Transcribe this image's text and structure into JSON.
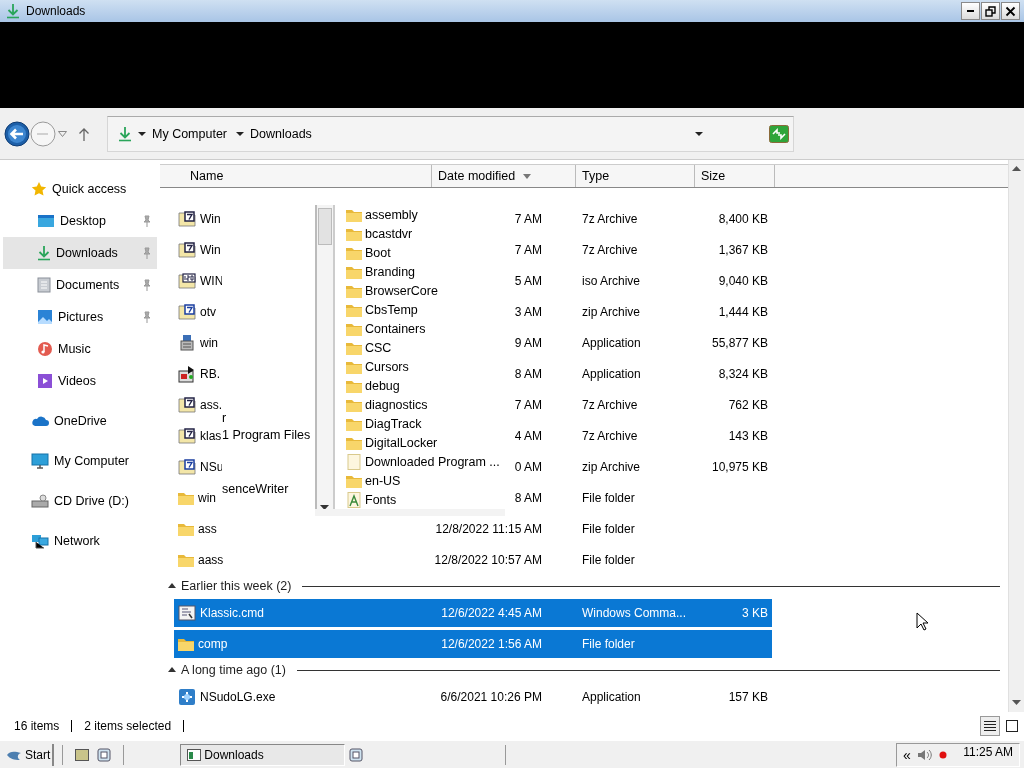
{
  "window": {
    "title": "Downloads"
  },
  "address_bar": {
    "breadcrumb": [
      "My Computer",
      "Downloads"
    ]
  },
  "sidebar": {
    "items": [
      {
        "label": "Quick access",
        "selected": false,
        "children": [
          {
            "label": "Desktop",
            "pinned": true,
            "selected": false
          },
          {
            "label": "Downloads",
            "pinned": true,
            "selected": true
          },
          {
            "label": "Documents",
            "pinned": true,
            "selected": false
          },
          {
            "label": "Pictures",
            "pinned": true,
            "selected": false
          },
          {
            "label": "Music",
            "pinned": false,
            "selected": false
          },
          {
            "label": "Videos",
            "pinned": false,
            "selected": false
          }
        ]
      },
      {
        "label": "OneDrive",
        "selected": false
      },
      {
        "label": "My Computer",
        "selected": false
      },
      {
        "label": "CD Drive (D:)",
        "selected": false
      },
      {
        "label": "Network",
        "selected": false
      }
    ]
  },
  "file_list": {
    "columns": [
      {
        "label": "Name",
        "sorted": false
      },
      {
        "label": "Date modified",
        "sorted": true
      },
      {
        "label": "Type",
        "sorted": false
      },
      {
        "label": "Size",
        "sorted": false
      }
    ],
    "rows": [
      {
        "kind": "sevenzip",
        "name": "Win",
        "date": "7 AM",
        "type": "7z Archive",
        "size": "8,400 KB",
        "selected": false
      },
      {
        "kind": "sevenzip",
        "name": "Win",
        "date": "7 AM",
        "type": "7z Archive",
        "size": "1,367 KB",
        "selected": false
      },
      {
        "kind": "iso",
        "name": "WIN",
        "date": "5 AM",
        "type": "iso Archive",
        "size": "9,040 KB",
        "selected": false
      },
      {
        "kind": "zip",
        "name": "otv",
        "date": "3 AM",
        "type": "zip Archive",
        "size": "1,444 KB",
        "selected": false
      },
      {
        "kind": "installer",
        "name": "win",
        "date": "9 AM",
        "type": "Application",
        "size": "55,877 KB",
        "selected": false
      },
      {
        "kind": "media",
        "name": "RB.",
        "date": "8 AM",
        "type": "Application",
        "size": "8,324 KB",
        "selected": false
      },
      {
        "kind": "sevenzip",
        "name": "ass.",
        "date": "7 AM",
        "type": "7z Archive",
        "size": "762 KB",
        "selected": false
      },
      {
        "kind": "sevenzip",
        "name": "klas",
        "date": "4 AM",
        "type": "7z Archive",
        "size": "143 KB",
        "selected": false
      },
      {
        "kind": "zip",
        "name": "NSu",
        "date": "0 AM",
        "type": "zip Archive",
        "size": "10,975 KB",
        "selected": false
      },
      {
        "kind": "folder",
        "name": "win",
        "date": "8 AM",
        "type": "File folder",
        "selected": false
      },
      {
        "kind": "folder",
        "name": "ass",
        "date": "12/8/2022 11:15 AM",
        "type": "File folder",
        "selected": false
      },
      {
        "kind": "folder",
        "name": "aass",
        "date": "12/8/2022 10:57 AM",
        "type": "File folder",
        "selected": false
      }
    ],
    "groups": [
      {
        "title": "Earlier this week (2)",
        "expanded": true,
        "rows": [
          {
            "kind": "cmd",
            "name": "Klassic.cmd",
            "date": "12/6/2022 4:45 AM",
            "type": "Windows Comma...",
            "size": "3 KB",
            "selected": true
          },
          {
            "kind": "folder",
            "name": "comp",
            "date": "12/6/2022 1:56 AM",
            "type": "File folder",
            "selected": true
          }
        ]
      },
      {
        "title": "A long time ago (1)",
        "expanded": true,
        "rows": [
          {
            "kind": "app",
            "name": "NSudoLG.exe",
            "date": "6/6/2021 10:26 PM",
            "type": "Application",
            "size": "157 KB",
            "selected": false
          }
        ]
      }
    ]
  },
  "folder_dropdown": {
    "fragments": [
      "r",
      "1 Program Files",
      "senceWriter"
    ],
    "items": [
      {
        "kind": "folder",
        "name": "assembly"
      },
      {
        "kind": "folder",
        "name": "bcastdvr"
      },
      {
        "kind": "folder",
        "name": "Boot"
      },
      {
        "kind": "folder",
        "name": "Branding"
      },
      {
        "kind": "folder",
        "name": "BrowserCore"
      },
      {
        "kind": "folder",
        "name": "CbsTemp"
      },
      {
        "kind": "folder",
        "name": "Containers"
      },
      {
        "kind": "folder",
        "name": "CSC"
      },
      {
        "kind": "folder",
        "name": "Cursors"
      },
      {
        "kind": "folder",
        "name": "debug"
      },
      {
        "kind": "folder",
        "name": "diagnostics"
      },
      {
        "kind": "folder",
        "name": "DiagTrack"
      },
      {
        "kind": "folder",
        "name": "DigitalLocker"
      },
      {
        "kind": "blank",
        "name": "Downloaded Program ..."
      },
      {
        "kind": "folder",
        "name": "en-US"
      },
      {
        "kind": "font",
        "name": "Fonts"
      }
    ]
  },
  "status_bar": {
    "items": [
      "16 items",
      "2 items selected"
    ],
    "views": [
      {
        "selected": true
      },
      {
        "selected": false
      }
    ]
  },
  "taskbar": {
    "start": "Start",
    "tasks": [
      {
        "label": "Downloads",
        "selected": true
      }
    ],
    "tray_toggle": "«",
    "clock": "11:25 AM"
  }
}
